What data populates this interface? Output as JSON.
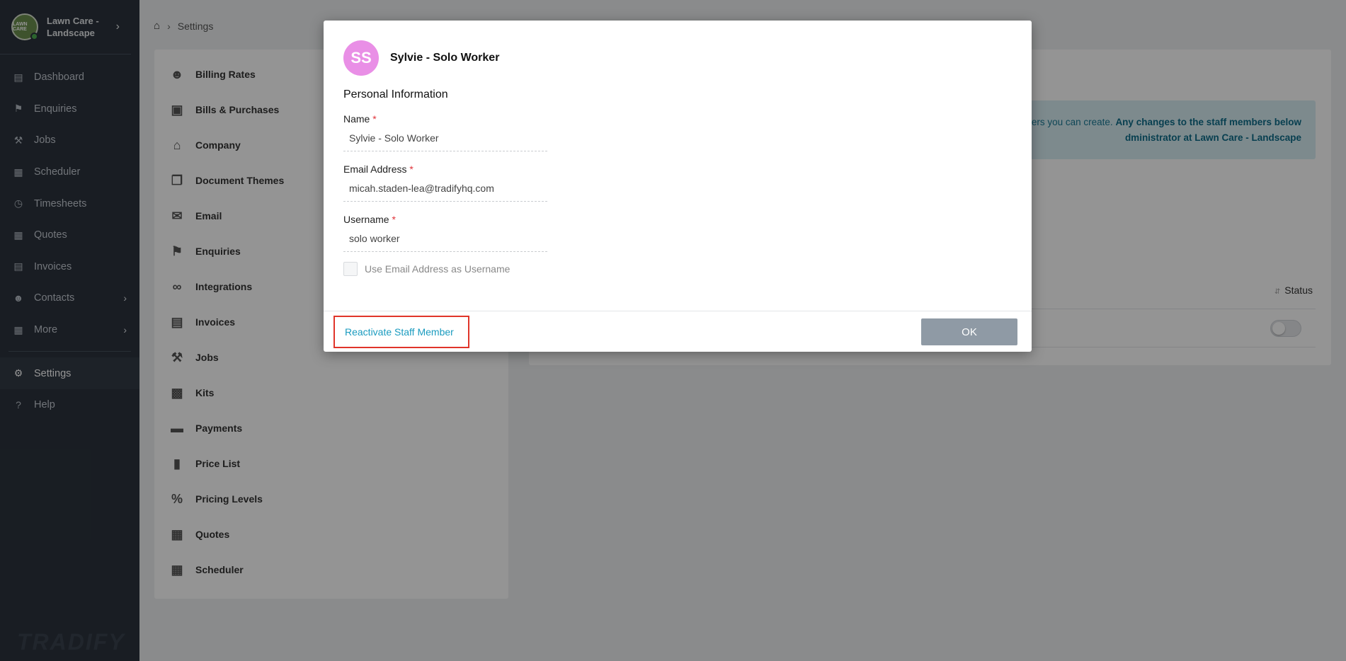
{
  "sidebar": {
    "brand_name": "Lawn Care - Landscape",
    "logo_text": "LAWN CARE",
    "items": [
      {
        "label": "Dashboard",
        "icon": "dashboard-icon"
      },
      {
        "label": "Enquiries",
        "icon": "tags-icon"
      },
      {
        "label": "Jobs",
        "icon": "hammer-icon"
      },
      {
        "label": "Scheduler",
        "icon": "calendar-icon"
      },
      {
        "label": "Timesheets",
        "icon": "clock-icon"
      },
      {
        "label": "Quotes",
        "icon": "calculator-icon"
      },
      {
        "label": "Invoices",
        "icon": "file-icon"
      },
      {
        "label": "Contacts",
        "icon": "users-icon"
      },
      {
        "label": "More",
        "icon": "grid-icon"
      },
      {
        "label": "Settings",
        "icon": "gear-icon"
      },
      {
        "label": "Help",
        "icon": "question-icon"
      }
    ],
    "footer_logo": "TRADIFY"
  },
  "breadcrumb": {
    "current": "Settings"
  },
  "settings_list": [
    "Billing Rates",
    "Bills & Purchases",
    "Company",
    "Document Themes",
    "Email",
    "Enquiries",
    "Integrations",
    "Invoices",
    "Jobs",
    "Kits",
    "Payments",
    "Price List",
    "Pricing Levels",
    "Quotes",
    "Scheduler"
  ],
  "info_box": {
    "line1_plain": "ers you can create. ",
    "line1_bold": "Any changes to the staff members below",
    "line2_bold": "dministrator at Lawn Care - Landscape"
  },
  "table": {
    "status_header": "Status"
  },
  "modal": {
    "avatar_initials": "SS",
    "title": "Sylvie - Solo Worker",
    "section_title": "Personal Information",
    "name_label": "Name",
    "name_value": "Sylvie - Solo Worker",
    "email_label": "Email Address",
    "email_value": "micah.staden-lea@tradifyhq.com",
    "username_label": "Username",
    "username_value": "solo worker",
    "checkbox_label": "Use Email Address as Username",
    "reactivate_label": "Reactivate Staff Member",
    "ok_label": "OK",
    "required_mark": "*"
  },
  "colors": {
    "sidebar_bg": "#2b333d",
    "avatar": "#e98fe6",
    "link": "#1a9bbf",
    "highlight_border": "#e0352a",
    "ok_button": "#8f9aa5"
  }
}
